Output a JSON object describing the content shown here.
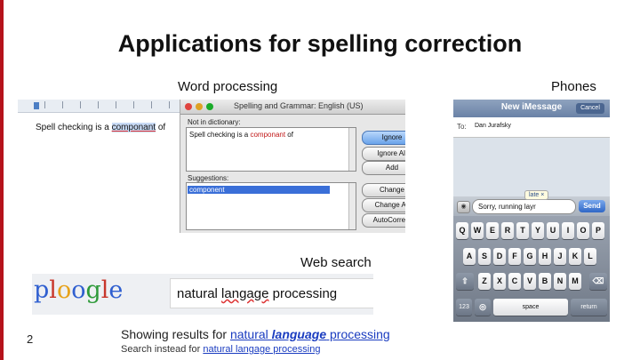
{
  "slide": {
    "title": "Applications for spelling correction",
    "page_number": "2",
    "accent_color": "#b5121b"
  },
  "word_processing": {
    "caption": "Word processing",
    "document_text_before": "Spell checking is a ",
    "document_misspelled": "componant",
    "document_text_after": " of",
    "dialog": {
      "title": "Spelling and Grammar: English (US)",
      "not_in_dictionary_label": "Not in dictionary:",
      "context_before": "Spell checking is a ",
      "context_error": "componant",
      "context_after": " of",
      "suggestions_label": "Suggestions:",
      "suggestions": [
        "component"
      ],
      "buttons": [
        "Ignore",
        "Ignore All",
        "Add",
        "Change",
        "Change All",
        "AutoCorrect"
      ]
    }
  },
  "phones": {
    "caption": "Phones",
    "nav_title": "New iMessage",
    "cancel_label": "Cancel",
    "to_label": "To:",
    "recipient": "Dan Jurafsky",
    "camera_icon": "camera-icon",
    "message_text": "Sorry, running layr",
    "suggestion": "late ×",
    "send_label": "Send",
    "keyboard": {
      "row1": [
        "Q",
        "W",
        "E",
        "R",
        "T",
        "Y",
        "U",
        "I",
        "O",
        "P"
      ],
      "row2": [
        "A",
        "S",
        "D",
        "F",
        "G",
        "H",
        "J",
        "K",
        "L"
      ],
      "row3": [
        "Z",
        "X",
        "C",
        "V",
        "B",
        "N",
        "M"
      ],
      "shift_icon": "shift-icon",
      "backspace_icon": "backspace-icon",
      "globe_icon": "globe-icon",
      "numbers_label": "123",
      "space_label": "space",
      "return_label": "return"
    }
  },
  "web_search": {
    "caption": "Web search",
    "logo_letters": [
      "p",
      "l",
      "o",
      "o",
      "g",
      "l",
      "e"
    ],
    "logo_colors": [
      "#2f5fd0",
      "#c8362b",
      "#e7a21a",
      "#2f5fd0",
      "#2e9a3a",
      "#c8362b",
      "#2f5fd0"
    ],
    "query_before": "natural ",
    "query_error": "langage",
    "query_after": " processing",
    "showing_prefix": "Showing results for ",
    "showing_link_start": "natural ",
    "showing_link_bold": "language",
    "showing_link_end": " processing",
    "instead_prefix": "Search instead for ",
    "instead_link": "natural langage processing"
  }
}
